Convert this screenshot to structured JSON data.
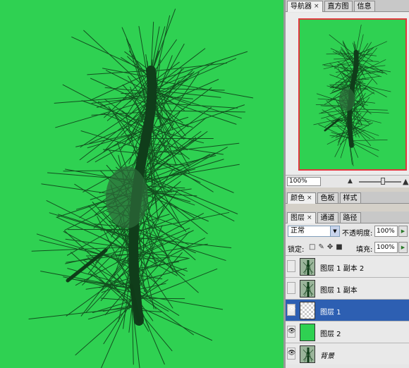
{
  "navigator_panel": {
    "tabs": [
      {
        "label": "导航器",
        "close": "×"
      },
      {
        "label": "直方图"
      },
      {
        "label": "信息"
      }
    ],
    "zoom_value": "100%"
  },
  "color_panel": {
    "tabs": [
      {
        "label": "颜色",
        "close": "×"
      },
      {
        "label": "色板"
      },
      {
        "label": "样式"
      }
    ]
  },
  "layers_panel": {
    "tabs": [
      {
        "label": "图层",
        "close": "×"
      },
      {
        "label": "通道"
      },
      {
        "label": "路径"
      }
    ],
    "blend_mode": "正常",
    "opacity_label": "不透明度:",
    "opacity_value": "100%",
    "lock_label": "锁定:",
    "fill_label": "填充:",
    "fill_value": "100%",
    "layers": [
      {
        "name": "图层 1 副本 2",
        "visible": false,
        "selected": false
      },
      {
        "name": "图层 1 副本",
        "visible": false,
        "selected": false
      },
      {
        "name": "图层 1",
        "visible": true,
        "selected": true
      },
      {
        "name": "图层 2",
        "visible": true,
        "selected": false
      },
      {
        "name": "背景",
        "visible": true,
        "selected": false
      }
    ]
  },
  "colors": {
    "canvas_background": "#2fd152",
    "selected_layer": "#2d5fb2",
    "navigator_frame": "#e2363d"
  }
}
